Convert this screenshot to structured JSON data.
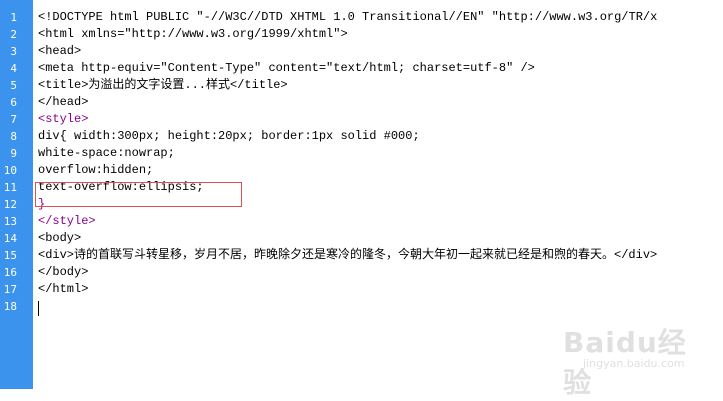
{
  "editor": {
    "line_numbers": [
      "1",
      "2",
      "3",
      "4",
      "5",
      "6",
      "7",
      "8",
      "9",
      "10",
      "11",
      "12",
      "13",
      "14",
      "15",
      "16",
      "17",
      "18"
    ],
    "lines": [
      "<!DOCTYPE html PUBLIC \"-//W3C//DTD XHTML 1.0 Transitional//EN\" \"http://www.w3.org/TR/x",
      "<html xmlns=\"http://www.w3.org/1999/xhtml\">",
      "<head>",
      "<meta http-equiv=\"Content-Type\" content=\"text/html; charset=utf-8\" />",
      "<title>为溢出的文字设置...样式</title>",
      "</head>",
      "<style>",
      "div{ width:300px; height:20px; border:1px solid #000;",
      "white-space:nowrap;",
      "overflow:hidden;",
      "text-overflow:ellipsis;",
      "}",
      "</style>",
      "<body>",
      "<div>诗的首联写斗转星移，岁月不居，昨晚除夕还是寒冷的隆冬，今朝大年初一起来就已经是和煦的春天。</div>",
      "</body>",
      "</html>",
      ""
    ]
  },
  "watermark": {
    "main": "Baidu经验",
    "sub": "jingyan.baidu.com"
  },
  "colors": {
    "gutter": "#3b93ee",
    "highlight": "#e05050",
    "css_purple": "#8b008b"
  }
}
